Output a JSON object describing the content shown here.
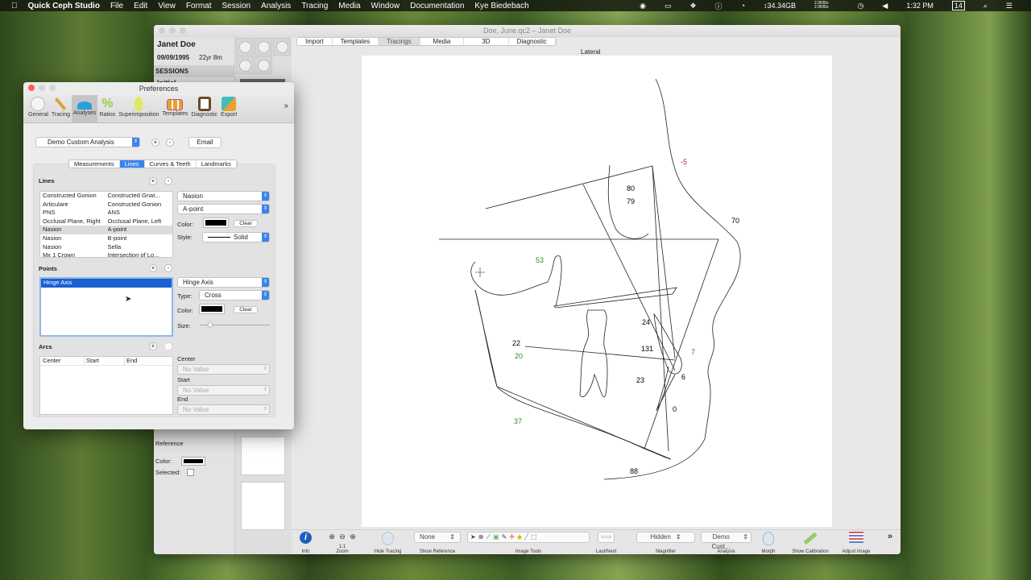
{
  "menubar": {
    "app": "Quick Ceph Studio",
    "items": [
      "File",
      "Edit",
      "View",
      "Format",
      "Session",
      "Analysis",
      "Tracing",
      "Media",
      "Window",
      "Documentation",
      "Kye Biedebach"
    ],
    "disk": "↕34.34GB",
    "net_up": "2.0KB/s",
    "net_down": "2.0KB/s",
    "time": "1:32 PM",
    "date_badge": "14"
  },
  "main_window": {
    "title": "Doe, June.qc2 – Janet Doe",
    "patient": {
      "name": "Janet Doe",
      "dob": "09/09/1995",
      "age": "22yr 8m",
      "sessions_header": "SESSIONS",
      "session": "Initial"
    },
    "tabs": [
      "Import",
      "Templates",
      "Tracings",
      "Media",
      "3D",
      "Diagnostic"
    ],
    "selected_tab": "Tracings",
    "view_label": "Lateral",
    "reference_panel": {
      "reference_label": "Reference",
      "color_label": "Color:",
      "selected_label": "Selected:"
    },
    "measurements": [
      {
        "value": "-5",
        "color": "#c0283c"
      },
      {
        "value": "80",
        "color": "#000"
      },
      {
        "value": "79",
        "color": "#000"
      },
      {
        "value": "70",
        "color": "#000"
      },
      {
        "value": "53",
        "color": "#2e8b2e"
      },
      {
        "value": "24",
        "color": "#000"
      },
      {
        "value": "131",
        "color": "#000"
      },
      {
        "value": "7",
        "color": "#2e8b2e"
      },
      {
        "value": "22",
        "color": "#000"
      },
      {
        "value": "20",
        "color": "#2e8b2e"
      },
      {
        "value": "6",
        "color": "#000"
      },
      {
        "value": "23",
        "color": "#000"
      },
      {
        "value": "0",
        "color": "#000"
      },
      {
        "value": "37",
        "color": "#2e8b2e"
      },
      {
        "value": "88",
        "color": "#000"
      }
    ],
    "toolbar": {
      "info": "Info",
      "zoom": "Zoom",
      "zoom_actual": "1:1",
      "hide_tracing": "Hide Tracing",
      "show_reference_value": "None",
      "show_reference": "Show Reference",
      "image_tools": "Image Tools",
      "last_next": "Last/Next",
      "magnifier_value": "Hidden",
      "magnifier": "Magnifier",
      "analysis_value": "Demo Cust...",
      "analysis": "Analysis",
      "morph": "Morph",
      "show_calibration": "Show Calibration",
      "adjust_image": "Adjust Image",
      "more": "»"
    }
  },
  "preferences": {
    "title": "Preferences",
    "toolbar": [
      "General",
      "Tracing",
      "Analyses",
      "Ratios",
      "Superimposition",
      "Templates",
      "Diagnostic",
      "Export"
    ],
    "selected": "Analyses",
    "more": "»",
    "analysis_select": "Demo Custom Analysis",
    "email": "Email",
    "add": "+",
    "remove": "-",
    "segments": [
      "Measurements",
      "Lines",
      "Curves & Teeth",
      "Landmarks"
    ],
    "selected_segment": "Lines",
    "lines": {
      "header": "Lines",
      "rows": [
        [
          "Constructed Gonion",
          "Constructed Gnat..."
        ],
        [
          "Articulare",
          "Constructed Gonion"
        ],
        [
          "PNS",
          "ANS"
        ],
        [
          "Occlusal Plane, Right",
          "Occlusal Plane, Left"
        ],
        [
          "Nasion",
          "A-point"
        ],
        [
          "Nasion",
          "B-point"
        ],
        [
          "Nasion",
          "Sella"
        ],
        [
          "Mx 1 Crown",
          "Intersection of Lo..."
        ]
      ],
      "from": "Nasion",
      "to": "A-point",
      "color_label": "Color:",
      "clear": "Clear",
      "style_label": "Style:",
      "style": "Solid"
    },
    "points": {
      "header": "Points",
      "items": [
        "Hinge Axis"
      ],
      "selected": "Hinge Axis",
      "type_label": "Type:",
      "type": "Cross",
      "color_label": "Color:",
      "clear": "Clear",
      "size_label": "Size:",
      "size_value": 0.15
    },
    "arcs": {
      "header": "Arcs",
      "columns": [
        "Center",
        "Start",
        "End"
      ],
      "center_label": "Center",
      "start_label": "Start",
      "end_label": "End",
      "no_value": "No Value"
    }
  }
}
